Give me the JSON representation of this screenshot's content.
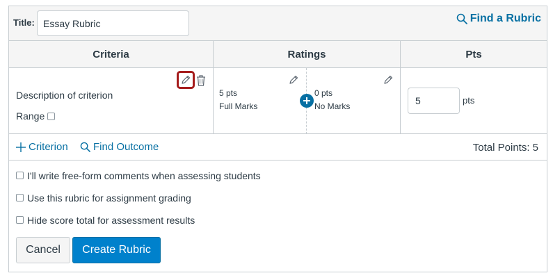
{
  "title": {
    "label": "Title:",
    "value": "Essay Rubric"
  },
  "find_rubric": {
    "label": "Find a Rubric",
    "icon": "search-icon"
  },
  "table": {
    "headers": {
      "criteria": "Criteria",
      "ratings": "Ratings",
      "pts": "Pts"
    },
    "criterion": {
      "description": "Description of criterion",
      "range_label": "Range",
      "range_checked": false,
      "edit_icon": "pencil-icon",
      "delete_icon": "trash-icon",
      "ratings": [
        {
          "points": "5 pts",
          "description": "Full Marks",
          "edit_icon": "pencil-icon"
        },
        {
          "points": "0 pts",
          "description": "No Marks",
          "edit_icon": "pencil-icon"
        }
      ],
      "add_rating_icon": "plus-circle-icon",
      "points_value": "5",
      "points_unit": "pts"
    }
  },
  "footer": {
    "add_criterion": "Criterion",
    "find_outcome": "Find Outcome",
    "total_points": "Total Points: 5"
  },
  "options": [
    {
      "label": "I'll write free-form comments when assessing students",
      "checked": false
    },
    {
      "label": "Use this rubric for assignment grading",
      "checked": false
    },
    {
      "label": "Hide score total for assessment results",
      "checked": false
    }
  ],
  "buttons": {
    "cancel": "Cancel",
    "create": "Create Rubric"
  },
  "colors": {
    "link": "#0770a3",
    "primary_button": "#0081cc",
    "highlight_border": "#a51c1c",
    "border": "#c7cdd1",
    "header_bg": "#f5f5f5",
    "text": "#2d3b45"
  }
}
